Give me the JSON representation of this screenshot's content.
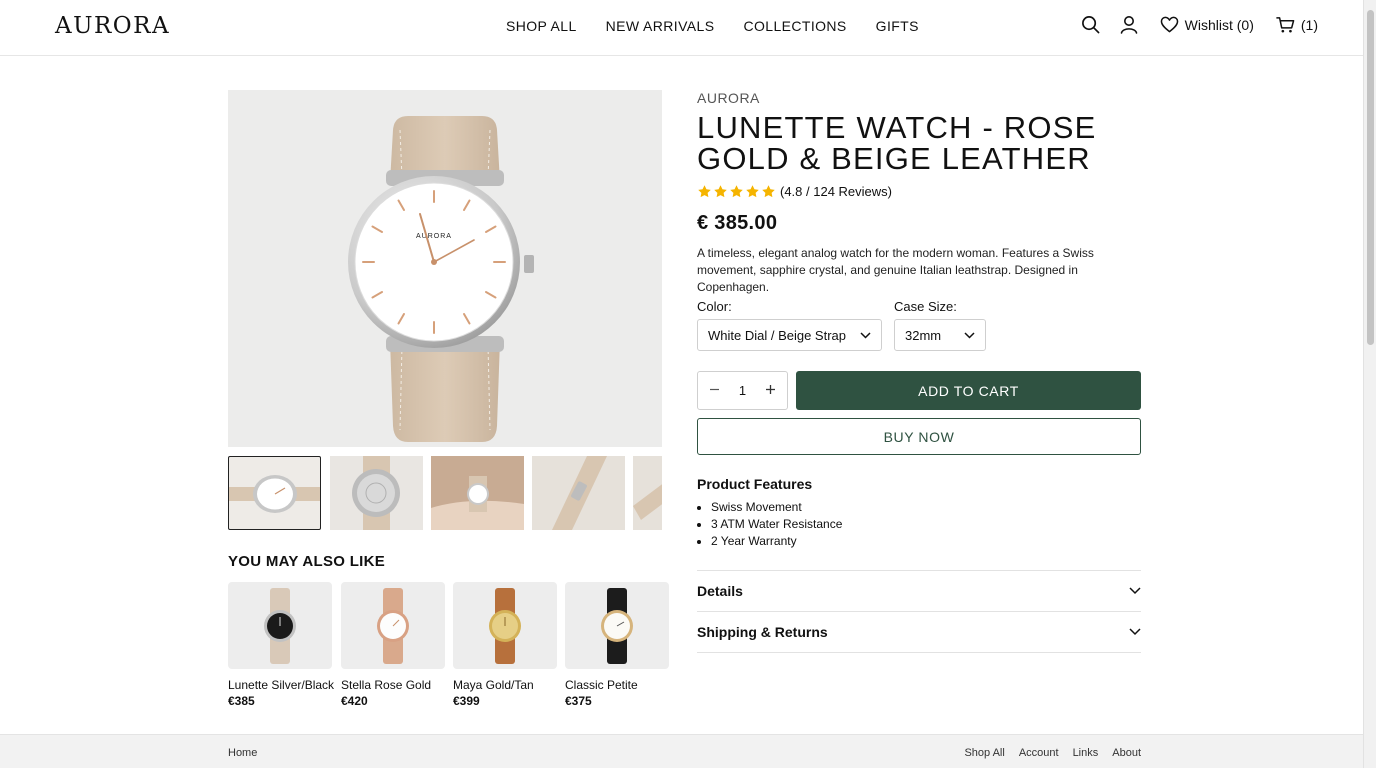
{
  "header": {
    "logo": "AURORA",
    "nav": [
      "SHOP ALL",
      "NEW ARRIVALS",
      "COLLECTIONS",
      "GIFTS"
    ],
    "wishlist_label": "Wishlist (0)",
    "cart_label": "(1)"
  },
  "product": {
    "brand": "AURORA",
    "title": "LUNETTE WATCH - ROSE GOLD & BEIGE LEATHER",
    "rating_text": "(4.8 / 124 Reviews)",
    "price": "€ 385.00",
    "description": "A timeless, elegant analog watch for the modern woman. Features a Swiss movement, sapphire crystal, and genuine Italian leathstrap. Designed in Copenhagen.",
    "color_label": "Color:",
    "color_value": "White Dial / Beige Strap",
    "size_label": "Case Size:",
    "size_value": "32mm",
    "quantity": "1",
    "add_to_cart": "ADD TO CART",
    "buy_now": "BUY NOW",
    "dial_brand": "AURORA",
    "colors": {
      "accent": "#2f5241",
      "strap": "#d8c6b1",
      "star": "#f5b400"
    }
  },
  "features": {
    "title": "Product Features",
    "items": [
      "Swiss Movement",
      "3 ATM Water Resistance",
      "2 Year Warranty"
    ]
  },
  "accordions": [
    "Details",
    "Shipping & Returns"
  ],
  "recommendations": {
    "title": "YOU MAY ALSO LIKE",
    "items": [
      {
        "name": "Lunette Silver/Black",
        "price": "€385"
      },
      {
        "name": "Stella Rose Gold",
        "price": "€420"
      },
      {
        "name": "Maya Gold/Tan",
        "price": "€399"
      },
      {
        "name": "Classic Petite",
        "price": "€375"
      }
    ]
  },
  "footer": {
    "home": "Home",
    "links": [
      "Shop All",
      "Account",
      "Links",
      "About"
    ]
  }
}
